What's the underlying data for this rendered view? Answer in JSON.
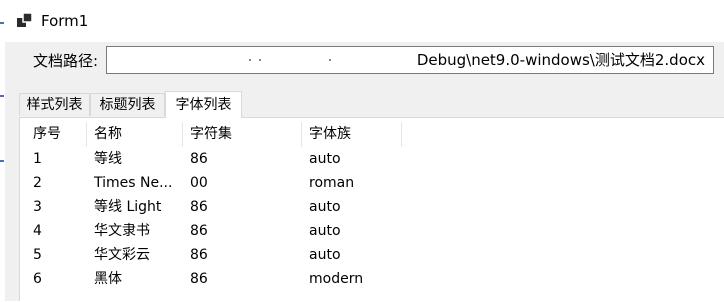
{
  "window": {
    "title": "Form1",
    "icon": "form-window-icon"
  },
  "path_row": {
    "label": "文档路径:",
    "value": "Debug\\net9.0-windows\\测试文档2.docx"
  },
  "tabs": [
    {
      "label": "样式列表",
      "active": false
    },
    {
      "label": "标题列表",
      "active": false
    },
    {
      "label": "字体列表",
      "active": true
    }
  ],
  "list": {
    "columns": [
      "序号",
      "名称",
      "字符集",
      "字体族"
    ],
    "rows": [
      [
        "1",
        "等线",
        "86",
        "auto"
      ],
      [
        "2",
        "Times Ne...",
        "00",
        "roman"
      ],
      [
        "3",
        "等线 Light",
        "86",
        "auto"
      ],
      [
        "4",
        "华文隶书",
        "86",
        "auto"
      ],
      [
        "5",
        "华文彩云",
        "86",
        "auto"
      ],
      [
        "6",
        "黑体",
        "86",
        "modern"
      ]
    ]
  },
  "colors": {
    "accent": "#0078d7",
    "border": "#7a7a7a",
    "client_bg": "#f0f0f0"
  }
}
